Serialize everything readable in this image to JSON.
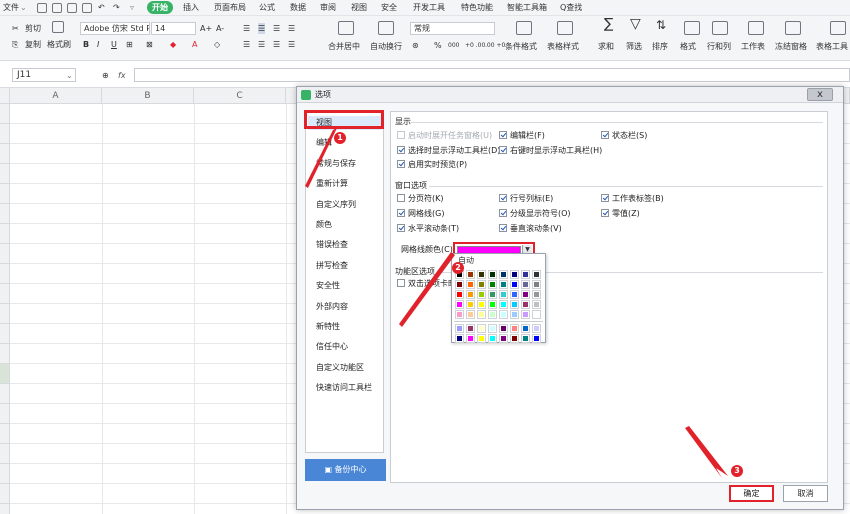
{
  "menubar": {
    "file": "文件",
    "start": "开始",
    "insert": "插入",
    "page_layout": "页面布局",
    "formula": "公式",
    "data": "数据",
    "review": "审阅",
    "view": "视图",
    "security": "安全",
    "dev_tools": "开发工具",
    "special": "特色功能",
    "smart_toolbox": "智能工具箱",
    "search": "Q查找"
  },
  "ribbon": {
    "cut": "剪切",
    "copy": "复制",
    "format_painter": "格式刷",
    "font_name": "Adobe 仿宋 Std R",
    "font_size": "14",
    "grow_font": "A+",
    "shrink_font": "A-",
    "bold": "B",
    "italic": "I",
    "underline": "U",
    "merge_center": "合并居中",
    "wrap_text": "自动换行",
    "number_format": "常规",
    "percent": "%",
    "thousands": "000",
    "inc_decimal": "+0 .00",
    "dec_decimal": ".00 +0",
    "cond_format": "条件格式",
    "table_style": "表格样式",
    "sum": "求和",
    "filter": "筛选",
    "sort": "排序",
    "format": "格式",
    "row_col": "行和列",
    "worksheet": "工作表",
    "freeze": "冻结窗格",
    "table_tools": "表格工具"
  },
  "formulabar": {
    "cell_ref": "J11",
    "fx": "fx"
  },
  "columns": [
    "A",
    "B",
    "C"
  ],
  "dialog": {
    "title": "选项",
    "close_label": "x",
    "nav": [
      {
        "label": "视图",
        "selected": true
      },
      {
        "label": "编辑"
      },
      {
        "label": "常规与保存"
      },
      {
        "label": "重新计算"
      },
      {
        "label": "自定义序列"
      },
      {
        "label": "颜色"
      },
      {
        "label": "错误检查"
      },
      {
        "label": "拼写检查"
      },
      {
        "label": "安全性"
      },
      {
        "label": "外部内容"
      },
      {
        "label": "新特性"
      },
      {
        "label": "信任中心"
      },
      {
        "label": "自定义功能区"
      },
      {
        "label": "快速访问工具栏"
      }
    ],
    "backup_label": "备份中心",
    "sections": {
      "display": "显示",
      "window": "窗口选项",
      "ribbon": "功能区选项"
    },
    "display_options": [
      {
        "label": "启动时展开任务窗格(U)",
        "checked": false,
        "disabled": true
      },
      {
        "label": "编辑栏(F)",
        "checked": true
      },
      {
        "label": "状态栏(S)",
        "checked": true
      },
      {
        "label": "选择时显示浮动工具栏(D)",
        "checked": true
      },
      {
        "label": "右键时显示浮动工具栏(H)",
        "checked": true
      },
      {
        "label": "启用实时预览(P)",
        "checked": true
      }
    ],
    "window_options": [
      {
        "label": "分页符(K)",
        "checked": false
      },
      {
        "label": "行号列标(E)",
        "checked": true
      },
      {
        "label": "工作表标签(B)",
        "checked": true
      },
      {
        "label": "网格线(G)",
        "checked": true
      },
      {
        "label": "分级显示符号(O)",
        "checked": true
      },
      {
        "label": "零值(Z)",
        "checked": true
      },
      {
        "label": "水平滚动条(T)",
        "checked": true
      },
      {
        "label": "垂直滚动条(V)",
        "checked": true
      }
    ],
    "gridline_color_label": "网格线颜色(C):",
    "gridline_color": "#ff00ff",
    "ribbon_option": {
      "label": "双击选项卡时",
      "checked": false
    },
    "palette_auto": "自动",
    "ok_label": "确定",
    "cancel_label": "取消"
  },
  "annotations": {
    "step1": "1",
    "step2": "2",
    "step3": "3",
    "color": "#e2222b"
  },
  "palette_colors": [
    [
      "#000000",
      "#993300",
      "#333300",
      "#003300",
      "#003366",
      "#000080",
      "#333399",
      "#333333"
    ],
    [
      "#800000",
      "#ff6600",
      "#808000",
      "#008000",
      "#008080",
      "#0000ff",
      "#666699",
      "#808080"
    ],
    [
      "#ff0000",
      "#ff9900",
      "#99cc00",
      "#339966",
      "#33cccc",
      "#3366ff",
      "#800080",
      "#969696"
    ],
    [
      "#ff00ff",
      "#ffcc00",
      "#ffff00",
      "#00ff00",
      "#00ffff",
      "#00ccff",
      "#993366",
      "#c0c0c0"
    ],
    [
      "#ff99cc",
      "#ffcc99",
      "#ffff99",
      "#ccffcc",
      "#ccffff",
      "#99ccff",
      "#cc99ff",
      "#ffffff"
    ],
    [
      "#9999ff",
      "#993366",
      "#ffffcc",
      "#ccffff",
      "#660066",
      "#ff8080",
      "#0066cc",
      "#ccccff"
    ],
    [
      "#000080",
      "#ff00ff",
      "#ffff00",
      "#00ffff",
      "#800080",
      "#800000",
      "#008080",
      "#0000ff"
    ]
  ]
}
